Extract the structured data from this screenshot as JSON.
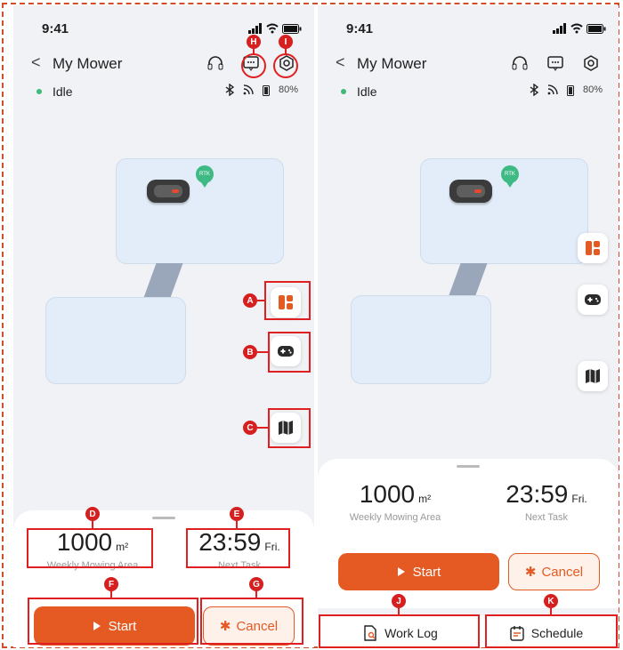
{
  "status_bar": {
    "time": "9:41"
  },
  "header": {
    "back_symbol": "<",
    "title": "My Mower"
  },
  "device": {
    "state": "Idle",
    "battery": "80%",
    "state_color": "#3dbb76"
  },
  "map": {
    "rtk_label": "RTK"
  },
  "stats": {
    "area_value": "1000",
    "area_unit": "m²",
    "area_label": "Weekly Mowing Area",
    "next_time": "23:59",
    "next_day": "Fri.",
    "next_label": "Next Task"
  },
  "actions": {
    "start": "Start",
    "cancel": "Cancel"
  },
  "tabs": {
    "work_log": "Work Log",
    "schedule": "Schedule"
  },
  "annotations": [
    "A",
    "B",
    "C",
    "D",
    "E",
    "F",
    "G",
    "H",
    "I",
    "J",
    "K"
  ],
  "colors": {
    "accent": "#e55a22",
    "annotation": "#e02020",
    "zone": "#e3edf9"
  }
}
